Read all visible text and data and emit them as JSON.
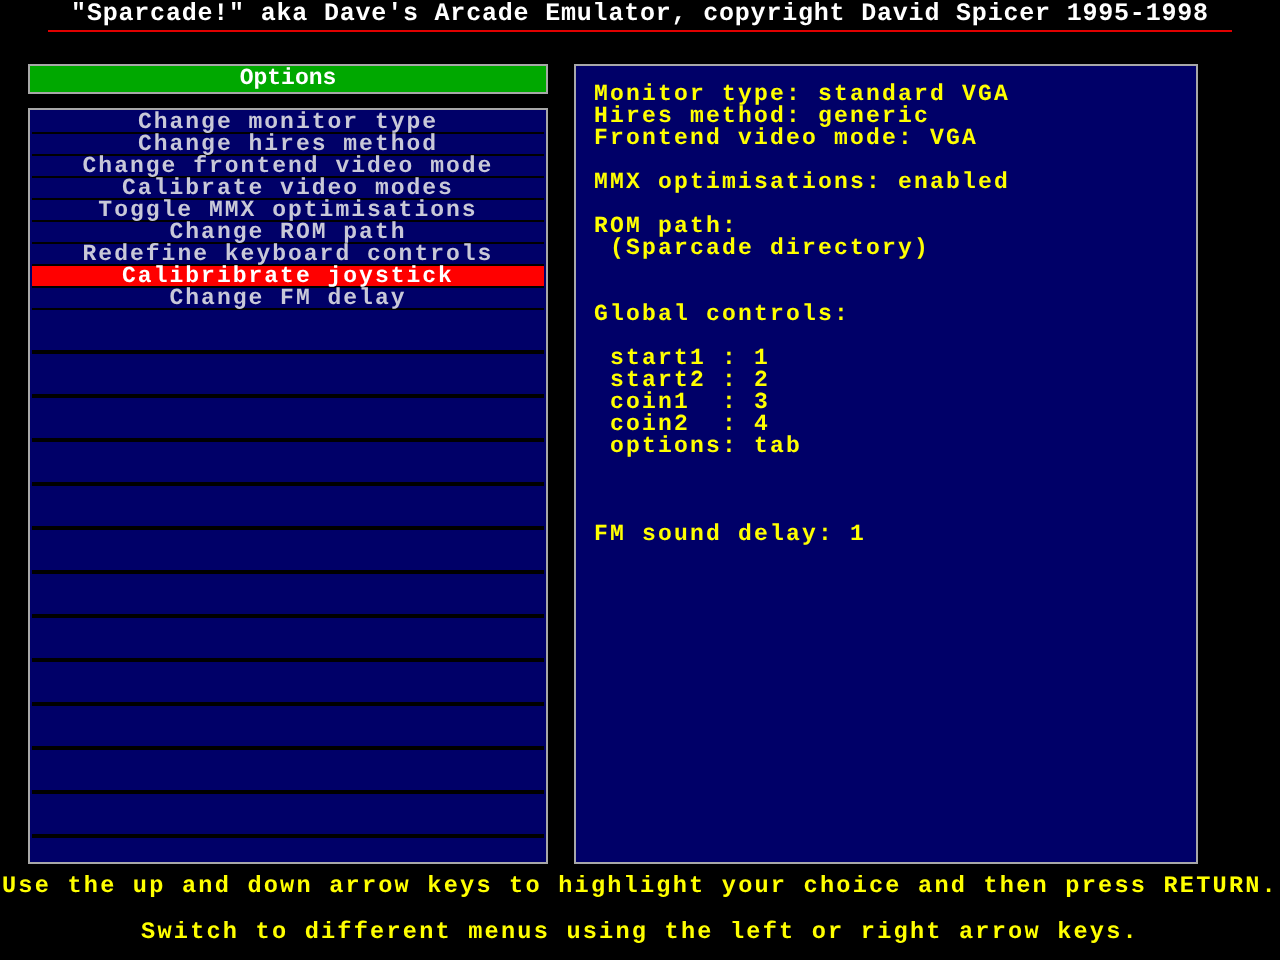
{
  "title": "\"Sparcade!\" aka Dave's Arcade Emulator, copyright David Spicer 1995-1998",
  "menu": {
    "header": "Options",
    "items": [
      {
        "label": "Change monitor type",
        "selected": false
      },
      {
        "label": "Change hires method",
        "selected": false
      },
      {
        "label": "Change frontend video mode",
        "selected": false
      },
      {
        "label": "Calibrate video modes",
        "selected": false
      },
      {
        "label": "Toggle MMX optimisations",
        "selected": false
      },
      {
        "label": "Change ROM path",
        "selected": false
      },
      {
        "label": "Redefine keyboard controls",
        "selected": false
      },
      {
        "label": "Calibribrate joystick",
        "selected": true
      },
      {
        "label": "Change FM delay",
        "selected": false
      }
    ]
  },
  "info": [
    {
      "kind": "text",
      "text": "Monitor type: standard VGA"
    },
    {
      "kind": "text",
      "text": "Hires method: generic"
    },
    {
      "kind": "text",
      "text": "Frontend video mode: VGA"
    },
    {
      "kind": "gap"
    },
    {
      "kind": "text",
      "text": "MMX optimisations: enabled"
    },
    {
      "kind": "gap"
    },
    {
      "kind": "text",
      "text": "ROM path:"
    },
    {
      "kind": "text",
      "text": " (Sparcade directory)"
    },
    {
      "kind": "gap"
    },
    {
      "kind": "gap"
    },
    {
      "kind": "text",
      "text": "Global controls:"
    },
    {
      "kind": "gap"
    },
    {
      "kind": "text",
      "text": " start1 : 1"
    },
    {
      "kind": "text",
      "text": " start2 : 2"
    },
    {
      "kind": "text",
      "text": " coin1  : 3"
    },
    {
      "kind": "text",
      "text": " coin2  : 4"
    },
    {
      "kind": "text",
      "text": " options: tab"
    },
    {
      "kind": "gap"
    },
    {
      "kind": "gap"
    },
    {
      "kind": "gap"
    },
    {
      "kind": "text",
      "text": "FM sound delay: 1"
    }
  ],
  "help": [
    "Use the up and down arrow keys to highlight your choice and then press RETURN.",
    "Switch to different menus using the left or right arrow keys."
  ]
}
